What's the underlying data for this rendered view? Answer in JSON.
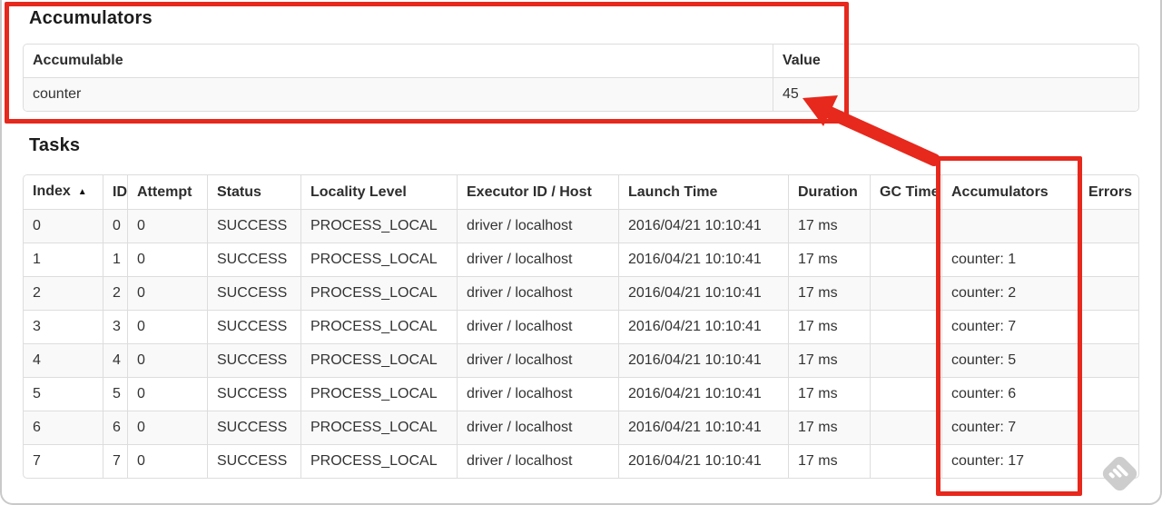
{
  "colors": {
    "annotation_red": "#e7281d",
    "row_stripe": "#f9f9f9",
    "table_border": "#dddddd",
    "text": "#333333",
    "watermark_gray": "#cdcdcd"
  },
  "accumulators_section": {
    "heading": "Accumulators",
    "table": {
      "headers": [
        "Accumulable",
        "Value"
      ],
      "rows": [
        [
          "counter",
          "45"
        ]
      ]
    }
  },
  "tasks_section": {
    "heading": "Tasks",
    "table": {
      "headers": [
        "Index",
        "ID",
        "Attempt",
        "Status",
        "Locality Level",
        "Executor ID / Host",
        "Launch Time",
        "Duration",
        "GC Time",
        "Accumulators",
        "Errors"
      ],
      "sort": {
        "column": "Index",
        "direction_icon": "▲"
      },
      "rows": [
        [
          "0",
          "0",
          "0",
          "SUCCESS",
          "PROCESS_LOCAL",
          "driver / localhost",
          "2016/04/21 10:10:41",
          "17 ms",
          "",
          "",
          ""
        ],
        [
          "1",
          "1",
          "0",
          "SUCCESS",
          "PROCESS_LOCAL",
          "driver / localhost",
          "2016/04/21 10:10:41",
          "17 ms",
          "",
          "counter: 1",
          ""
        ],
        [
          "2",
          "2",
          "0",
          "SUCCESS",
          "PROCESS_LOCAL",
          "driver / localhost",
          "2016/04/21 10:10:41",
          "17 ms",
          "",
          "counter: 2",
          ""
        ],
        [
          "3",
          "3",
          "0",
          "SUCCESS",
          "PROCESS_LOCAL",
          "driver / localhost",
          "2016/04/21 10:10:41",
          "17 ms",
          "",
          "counter: 7",
          ""
        ],
        [
          "4",
          "4",
          "0",
          "SUCCESS",
          "PROCESS_LOCAL",
          "driver / localhost",
          "2016/04/21 10:10:41",
          "17 ms",
          "",
          "counter: 5",
          ""
        ],
        [
          "5",
          "5",
          "0",
          "SUCCESS",
          "PROCESS_LOCAL",
          "driver / localhost",
          "2016/04/21 10:10:41",
          "17 ms",
          "",
          "counter: 6",
          ""
        ],
        [
          "6",
          "6",
          "0",
          "SUCCESS",
          "PROCESS_LOCAL",
          "driver / localhost",
          "2016/04/21 10:10:41",
          "17 ms",
          "",
          "counter: 7",
          ""
        ],
        [
          "7",
          "7",
          "0",
          "SUCCESS",
          "PROCESS_LOCAL",
          "driver / localhost",
          "2016/04/21 10:10:41",
          "17 ms",
          "",
          "counter: 17",
          ""
        ]
      ]
    }
  },
  "annotations": {
    "color": "#e7281d",
    "items": [
      "box-around-accumulators-summary-table",
      "box-around-tasks-accumulators-column",
      "arrow-from-accumulators-column-to-value-45"
    ]
  }
}
